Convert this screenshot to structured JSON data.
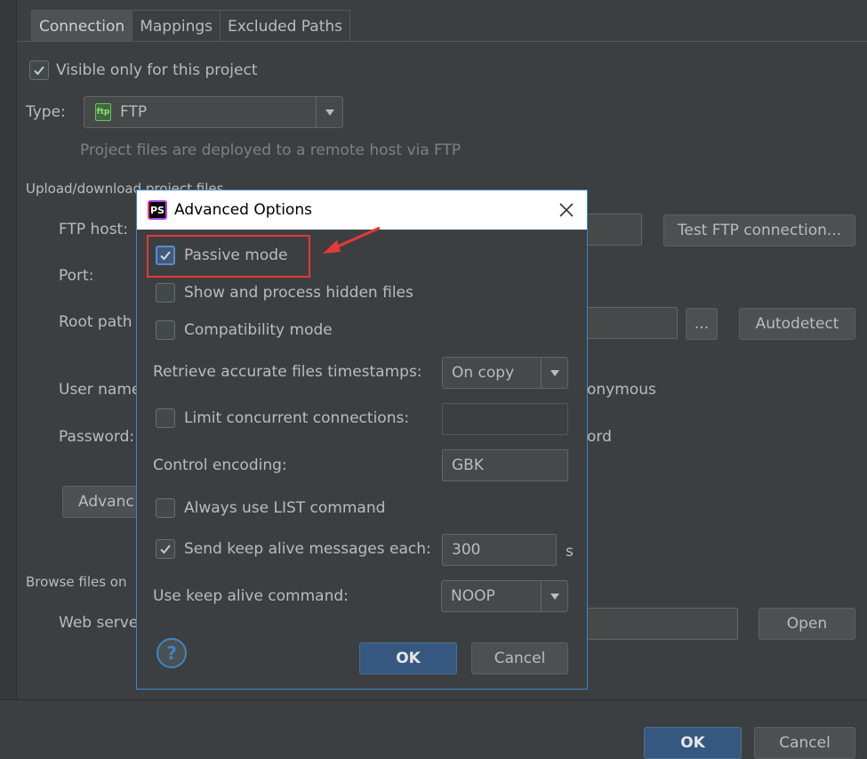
{
  "tabs": [
    "Connection",
    "Mappings",
    "Excluded Paths"
  ],
  "visible_only": {
    "label": "Visible only for this project",
    "checked": true
  },
  "type": {
    "label": "Type:",
    "value": "FTP",
    "icon": "ftp-icon"
  },
  "type_description": "Project files are deployed to a remote host via FTP",
  "section_upload": "Upload/download project files",
  "ftp_host_label": "FTP host:",
  "test_button": "Test FTP connection...",
  "port_label": "Port:",
  "root_path_label": "Root path",
  "browse_button": "...",
  "autodetect_button": "Autodetect",
  "user_name_label": "User name",
  "anonymous_text": "onymous",
  "password_label": "Password:",
  "save_password_text": "ord",
  "advanced_button": "Advanc",
  "section_browse": "Browse files on",
  "web_server_label": "Web serve",
  "open_button": "Open",
  "bottom_ok": "OK",
  "bottom_cancel": "Cancel",
  "dialog": {
    "title": "Advanced Options",
    "app_icon": "PS",
    "passive_mode": {
      "label": "Passive mode",
      "checked": true
    },
    "show_hidden": {
      "label": "Show and process hidden files",
      "checked": false
    },
    "compat_mode": {
      "label": "Compatibility mode",
      "checked": false
    },
    "timestamps": {
      "label": "Retrieve accurate files timestamps:",
      "value": "On copy"
    },
    "limit_conn": {
      "label": "Limit concurrent connections:",
      "checked": false,
      "value": ""
    },
    "encoding": {
      "label": "Control encoding:",
      "value": "GBK"
    },
    "list_cmd": {
      "label": "Always use LIST command",
      "checked": false
    },
    "keep_alive": {
      "label": "Send keep alive messages each:",
      "checked": true,
      "value": "300",
      "unit": "s"
    },
    "keep_alive_cmd": {
      "label": "Use keep alive command:",
      "value": "NOOP"
    },
    "help": "?",
    "ok": "OK",
    "cancel": "Cancel"
  },
  "colors": {
    "accent": "#3d86c8",
    "annotation": "#e53935",
    "background": "#3c3f41"
  }
}
